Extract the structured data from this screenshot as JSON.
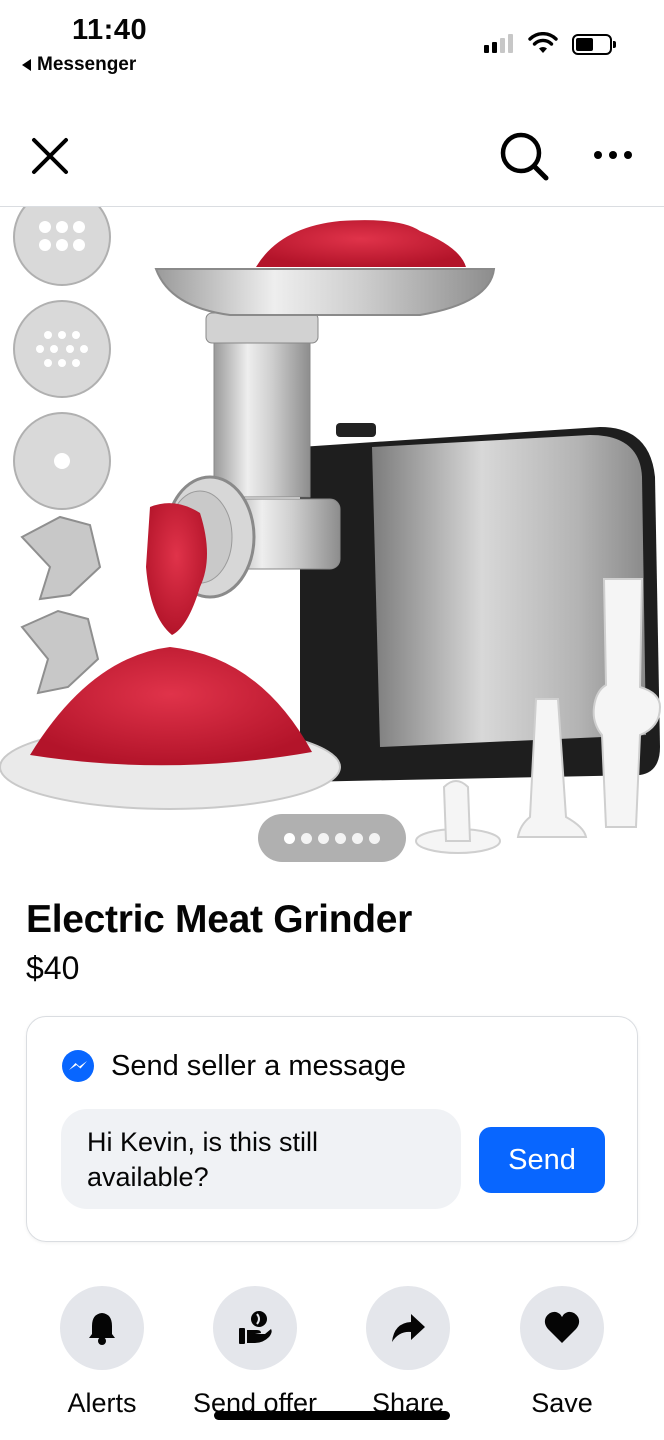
{
  "status_bar": {
    "time": "11:40",
    "back_app": "Messenger",
    "icons": [
      "signal-icon",
      "wifi-icon",
      "battery-icon"
    ]
  },
  "nav": {
    "icons": [
      "close-icon",
      "search-icon",
      "more-icon"
    ]
  },
  "carousel": {
    "total_images": 6,
    "active_index": 0
  },
  "listing": {
    "title": "Electric Meat Grinder",
    "price": "$40"
  },
  "message_card": {
    "icon": "messenger-icon",
    "heading": "Send seller a message",
    "input_value": "Hi Kevin, is this still available?",
    "send_label": "Send"
  },
  "actions": [
    {
      "label": "Alerts",
      "icon": "bell-icon"
    },
    {
      "label": "Send offer",
      "icon": "offer-icon"
    },
    {
      "label": "Share",
      "icon": "share-icon"
    },
    {
      "label": "Save",
      "icon": "heart-icon"
    }
  ],
  "colors": {
    "accent": "#0866ff",
    "chip_bg": "#e4e6eb",
    "input_bg": "#f0f2f5",
    "text": "#050505"
  }
}
